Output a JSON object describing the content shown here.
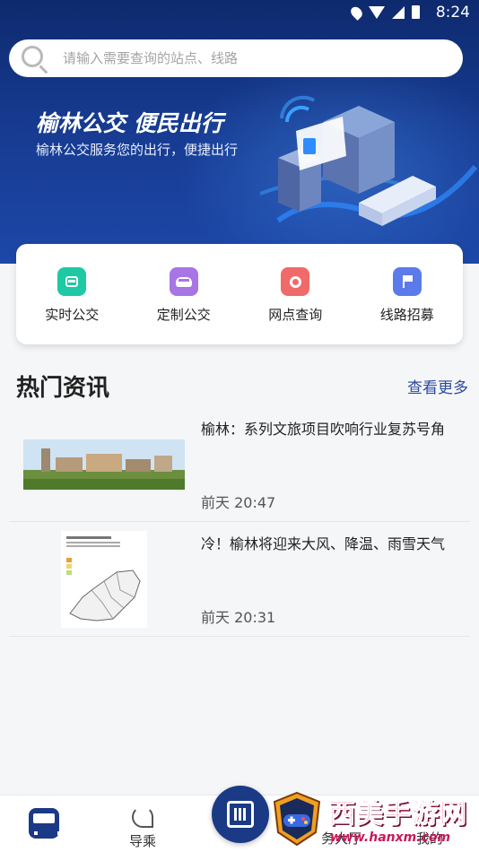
{
  "status_bar": {
    "time": "8:24"
  },
  "search": {
    "placeholder": "请输入需要查询的站点、线路"
  },
  "banner": {
    "title": "榆林公交 便民出行",
    "subtitle": "榆林公交服务您的出行，便捷出行"
  },
  "functions": [
    {
      "label": "实时公交",
      "icon": "bus-icon",
      "color": "#1ec9a3"
    },
    {
      "label": "定制公交",
      "icon": "van-icon",
      "color": "#a875e5"
    },
    {
      "label": "网点查询",
      "icon": "location-pin-icon",
      "color": "#f06a6a"
    },
    {
      "label": "线路招募",
      "icon": "flag-icon",
      "color": "#5b7bea"
    }
  ],
  "news": {
    "section_title": "热门资讯",
    "more_label": "查看更多",
    "items": [
      {
        "title": "榆林：系列文旅项目吹响行业复苏号角",
        "time": "前天  20:47"
      },
      {
        "title": "冷！榆林将迎来大风、降温、雨雪天气",
        "time": "前天  20:31"
      }
    ]
  },
  "bottom_nav": {
    "items": [
      {
        "label": "",
        "icon": "bus-icon",
        "active": true
      },
      {
        "label": "导乘",
        "icon": "route-icon"
      },
      {
        "label": "",
        "icon": "qr-code-icon"
      },
      {
        "label": "务大厅",
        "icon": "service-hall-icon"
      },
      {
        "label": "我的",
        "icon": "user-icon"
      }
    ]
  },
  "watermark": {
    "title": "西美手游网",
    "url": "www.hanxm.com"
  },
  "colors": {
    "primary": "#1b3a86",
    "banner_bg": "#163a8f",
    "link": "#2a4a9e"
  }
}
